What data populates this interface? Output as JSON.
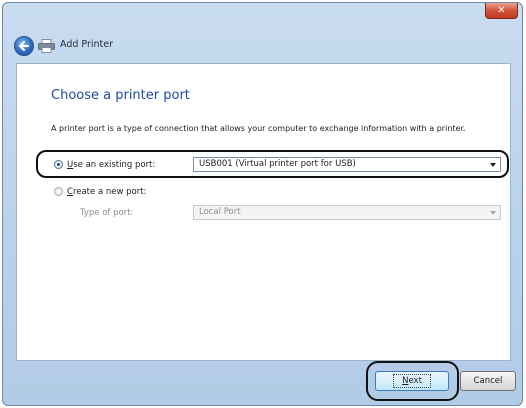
{
  "window": {
    "close_glyph": "✕",
    "title": "Add Printer",
    "back_icon": "back-arrow-icon",
    "title_icon": "printer-icon"
  },
  "page": {
    "heading": "Choose a printer port",
    "description": "A printer port is a type of connection that allows your computer to exchange information with a printer."
  },
  "options": {
    "existing": {
      "label_accel": "U",
      "label_rest": "se an existing port:",
      "selected": true,
      "value": "USB001 (Virtual printer port for USB)"
    },
    "new": {
      "label_accel": "C",
      "label_rest": "reate a new port:",
      "selected": false
    },
    "type_of_port": {
      "label": "Type of port:",
      "value": "Local Port"
    }
  },
  "buttons": {
    "next_accel": "N",
    "next_rest": "ext",
    "cancel": "Cancel"
  },
  "colors": {
    "heading": "#1f4a9b",
    "frame": "#b9d1ea",
    "highlight_ring": "#111111"
  }
}
